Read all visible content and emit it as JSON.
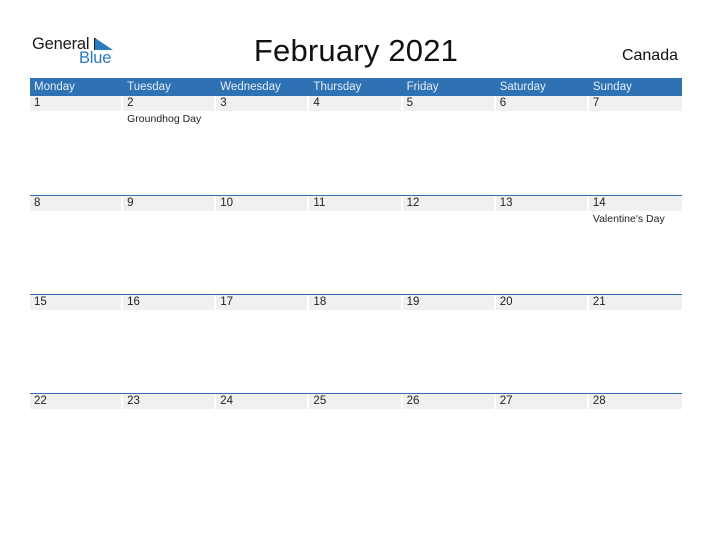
{
  "logo": {
    "line1": "General",
    "line2": "Blue",
    "icon": "flag-triangle-icon"
  },
  "title": "February 2021",
  "country": "Canada",
  "colors": {
    "accent": "#2e72b4",
    "logo_blue": "#2a7ac0",
    "date_strip": "#f0f0f0"
  },
  "weekdays": [
    "Monday",
    "Tuesday",
    "Wednesday",
    "Thursday",
    "Friday",
    "Saturday",
    "Sunday"
  ],
  "weeks": [
    {
      "days": [
        {
          "date": "1",
          "holiday": ""
        },
        {
          "date": "2",
          "holiday": "Groundhog Day"
        },
        {
          "date": "3",
          "holiday": ""
        },
        {
          "date": "4",
          "holiday": ""
        },
        {
          "date": "5",
          "holiday": ""
        },
        {
          "date": "6",
          "holiday": ""
        },
        {
          "date": "7",
          "holiday": ""
        }
      ]
    },
    {
      "days": [
        {
          "date": "8",
          "holiday": ""
        },
        {
          "date": "9",
          "holiday": ""
        },
        {
          "date": "10",
          "holiday": ""
        },
        {
          "date": "11",
          "holiday": ""
        },
        {
          "date": "12",
          "holiday": ""
        },
        {
          "date": "13",
          "holiday": ""
        },
        {
          "date": "14",
          "holiday": "Valentine's Day"
        }
      ]
    },
    {
      "days": [
        {
          "date": "15",
          "holiday": ""
        },
        {
          "date": "16",
          "holiday": ""
        },
        {
          "date": "17",
          "holiday": ""
        },
        {
          "date": "18",
          "holiday": ""
        },
        {
          "date": "19",
          "holiday": ""
        },
        {
          "date": "20",
          "holiday": ""
        },
        {
          "date": "21",
          "holiday": ""
        }
      ]
    },
    {
      "days": [
        {
          "date": "22",
          "holiday": ""
        },
        {
          "date": "23",
          "holiday": ""
        },
        {
          "date": "24",
          "holiday": ""
        },
        {
          "date": "25",
          "holiday": ""
        },
        {
          "date": "26",
          "holiday": ""
        },
        {
          "date": "27",
          "holiday": ""
        },
        {
          "date": "28",
          "holiday": ""
        }
      ]
    }
  ]
}
